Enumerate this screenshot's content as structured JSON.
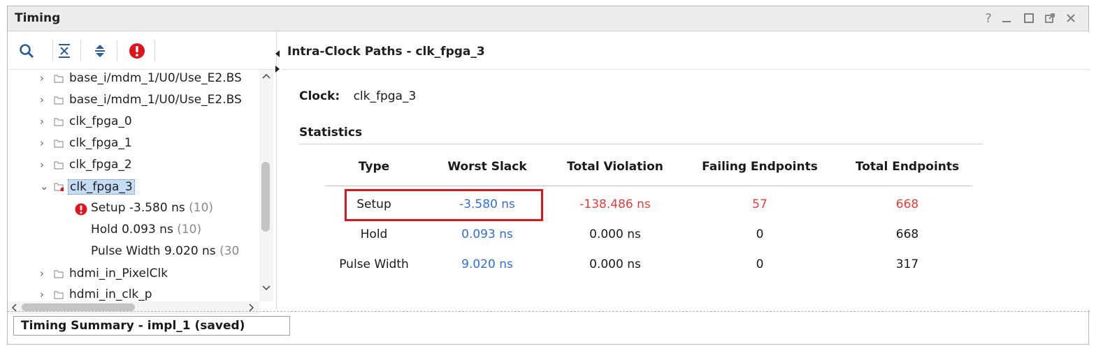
{
  "window": {
    "title": "Timing",
    "controls": [
      "?",
      "minimize-icon",
      "maximize-icon",
      "float-icon",
      "close-icon"
    ],
    "help_label": "?"
  },
  "toolbar": {
    "icons": [
      "search-icon",
      "collapse-all-icon",
      "expand-all-icon",
      "error-icon"
    ]
  },
  "tree": {
    "items": [
      {
        "label": "base_i/mdm_1/U0/Use_E2.BS",
        "expander": "›"
      },
      {
        "label": "base_i/mdm_1/U0/Use_E2.BS",
        "expander": "›"
      },
      {
        "label": "clk_fpga_0",
        "expander": "›"
      },
      {
        "label": "clk_fpga_1",
        "expander": "›"
      },
      {
        "label": "clk_fpga_2",
        "expander": "›"
      },
      {
        "label": "clk_fpga_3",
        "expander": "⌄",
        "selected": true
      },
      {
        "label": "Setup -3.580 ns",
        "count": "(10)",
        "error": true
      },
      {
        "label": "Hold 0.093 ns",
        "count": "(10)"
      },
      {
        "label": "Pulse Width 9.020 ns",
        "count": "(30"
      },
      {
        "label": "hdmi_in_PixelClk",
        "expander": "›"
      },
      {
        "label": "hdmi_in_clk_p",
        "expander": "›"
      }
    ]
  },
  "details": {
    "header": "Intra-Clock Paths - clk_fpga_3",
    "clock_label": "Clock:",
    "clock_value": "clk_fpga_3",
    "statistics_title": "Statistics",
    "columns": [
      "Type",
      "Worst Slack",
      "Total Violation",
      "Failing Endpoints",
      "Total Endpoints"
    ],
    "rows": [
      {
        "type": "Setup",
        "worst_slack": "-3.580 ns",
        "total_violation": "-138.486 ns",
        "failing_endpoints": "57",
        "total_endpoints": "668",
        "status": "fail"
      },
      {
        "type": "Hold",
        "worst_slack": "0.093 ns",
        "total_violation": "0.000 ns",
        "failing_endpoints": "0",
        "total_endpoints": "668",
        "status": "pass"
      },
      {
        "type": "Pulse Width",
        "worst_slack": "9.020 ns",
        "total_violation": "0.000 ns",
        "failing_endpoints": "0",
        "total_endpoints": "317",
        "status": "pass"
      }
    ]
  },
  "bottom_tab": {
    "label": "Timing Summary - impl_1 (saved)"
  },
  "colors": {
    "slack_link": "#2f6fe0",
    "violation": "#ef3a3a",
    "highlight_box": "#e0141c",
    "selection": "#c5dcf6"
  }
}
